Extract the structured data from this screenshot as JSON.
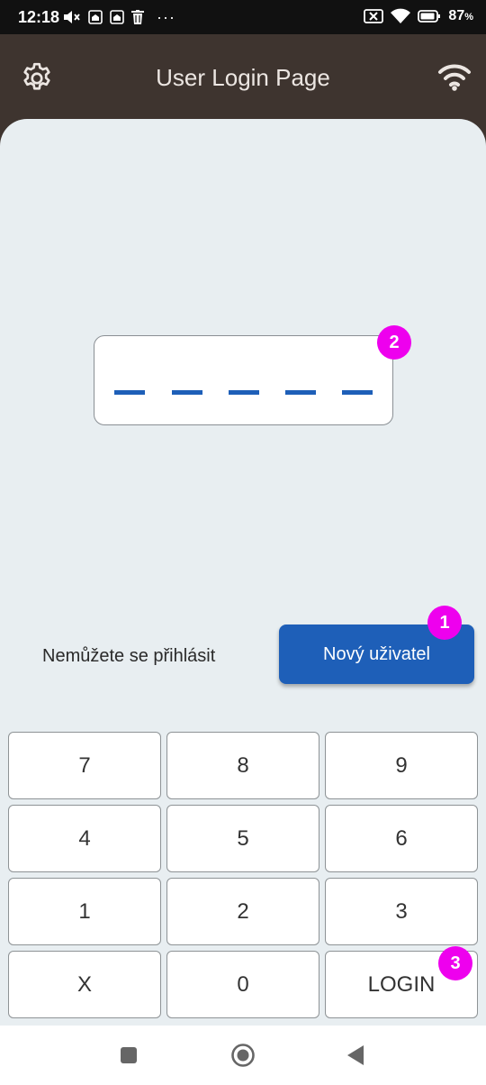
{
  "status_bar": {
    "time": "12:18",
    "battery": "87",
    "battery_unit": "%",
    "left_icons": [
      "mute-icon",
      "home-notification-icon",
      "home-notification-icon",
      "trash-icon"
    ],
    "more": "···",
    "right_icons": [
      "no-sim-icon",
      "wifi-icon",
      "battery-icon"
    ]
  },
  "app_bar": {
    "title": "User Login Page",
    "left_icon": "gear-icon",
    "right_icon": "wifi-icon",
    "bar_color": "#3e342f"
  },
  "pin": {
    "length": 5,
    "dash_color": "#1e5fb8"
  },
  "badges": {
    "new_user": "1",
    "pin": "2",
    "login": "3",
    "color": "#ee00ee"
  },
  "actions": {
    "cant_login": "Nemůžete se přihlásit",
    "new_user": "Nový uživatel",
    "accent": "#1e5fb8"
  },
  "keypad": {
    "keys": [
      "7",
      "8",
      "9",
      "4",
      "5",
      "6",
      "1",
      "2",
      "3",
      "X",
      "0",
      "LOGIN"
    ]
  },
  "nav_bar": {
    "icons": [
      "recents-square-icon",
      "home-circle-icon",
      "back-triangle-icon"
    ]
  }
}
